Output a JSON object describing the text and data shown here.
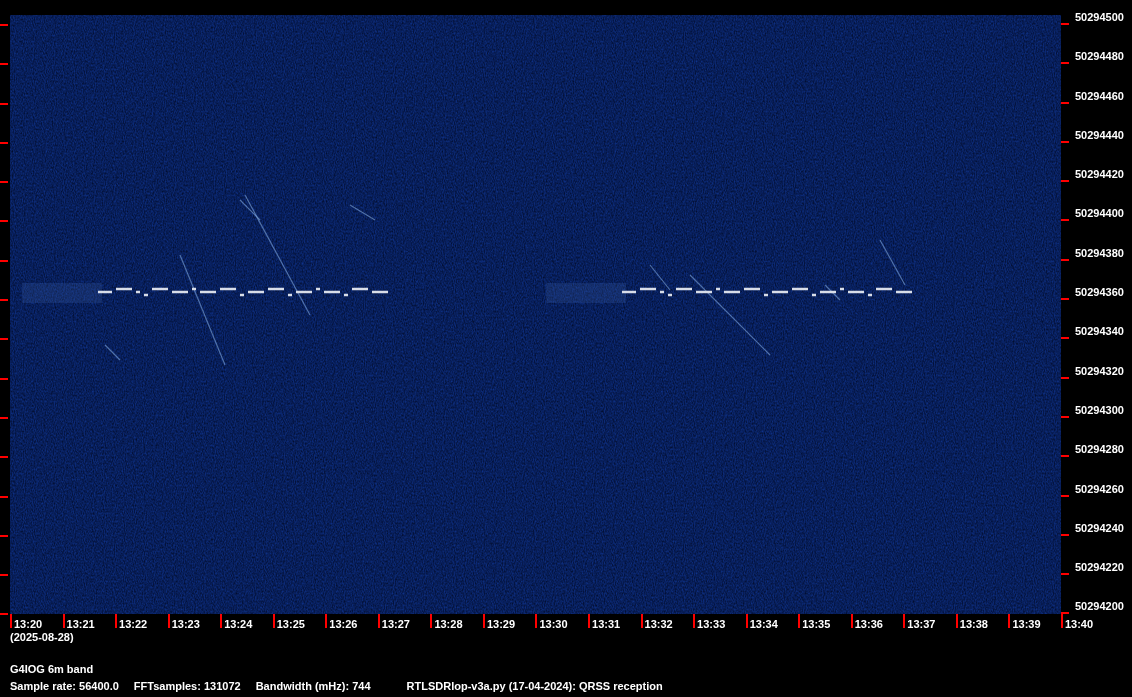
{
  "plot": {
    "frequency_ticks": [
      "50294500",
      "50294480",
      "50294460",
      "50294440",
      "50294420",
      "50294400",
      "50294380",
      "50294360",
      "50294340",
      "50294320",
      "50294300",
      "50294280",
      "50294260",
      "50294240",
      "50294220",
      "50294200"
    ],
    "time_ticks": [
      "13:20",
      "13:21",
      "13:22",
      "13:23",
      "13:24",
      "13:25",
      "13:26",
      "13:27",
      "13:28",
      "13:29",
      "13:30",
      "13:31",
      "13:32",
      "13:33",
      "13:34",
      "13:35",
      "13:36",
      "13:37",
      "13:38",
      "13:39",
      "13:40"
    ],
    "date": "(2025-08-28)"
  },
  "footer": {
    "station": "G4IOG 6m band",
    "fields": [
      "Sample rate: 56400.0",
      "FFTsamples: 131072",
      "Bandwidth (mHz): 744",
      "RTLSDRlop-v3a.py (17-04-2024): QRSS reception"
    ]
  }
}
